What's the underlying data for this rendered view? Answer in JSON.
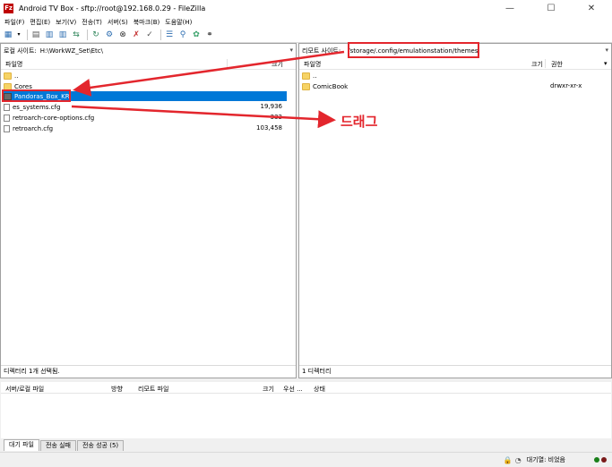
{
  "window": {
    "title": "Android TV Box - sftp://root@192.168.0.29 - FileZilla",
    "app_icon": "Fz",
    "controls": [
      "minimize-icon",
      "maximize-icon",
      "close-icon"
    ]
  },
  "menu": [
    "파일(F)",
    "편집(E)",
    "보기(V)",
    "전송(T)",
    "서버(S)",
    "북마크(B)",
    "도움말(H)"
  ],
  "toolbar_icons": [
    "site-manager-icon",
    "toggle-log-icon",
    "toggle-local-tree-icon",
    "toggle-remote-tree-icon",
    "toggle-queue-icon",
    "refresh-icon",
    "process-queue-icon",
    "cancel-icon",
    "disconnect-icon",
    "reconnect-icon",
    "filter-icon",
    "compare-icon",
    "sync-browse-icon",
    "find-icon"
  ],
  "local": {
    "address_label": "로컬 사이트:",
    "address_value": "H:\\WorkWZ_Set\\Etc\\",
    "col_name": "파일명",
    "col_size": "크기",
    "items": [
      {
        "name": "..",
        "type": "parent",
        "size": ""
      },
      {
        "name": "Cores",
        "type": "folder",
        "size": ""
      },
      {
        "name": "Pandoras_Box_KR",
        "type": "folder-selected",
        "size": ""
      },
      {
        "name": "es_systems.cfg",
        "type": "file",
        "size": "19,936"
      },
      {
        "name": "retroarch-core-options.cfg",
        "type": "file",
        "size": "333"
      },
      {
        "name": "retroarch.cfg",
        "type": "file",
        "size": "103,458"
      }
    ],
    "status": "디렉터리 1개 선택됨."
  },
  "remote": {
    "address_label": "리모트 사이트:",
    "address_value": "/storage/.config/emulationstation/themes",
    "col_name": "파일명",
    "col_size": "크기",
    "col_perm": "권한",
    "items": [
      {
        "name": "..",
        "type": "parent",
        "perm": ""
      },
      {
        "name": "ComicBook",
        "type": "folder",
        "perm": "drwxr-xr-x"
      }
    ],
    "status": "1 디렉터리"
  },
  "queue": {
    "columns": [
      "서버/로컬 파일",
      "방향",
      "리모트 파일",
      "크기",
      "우선 ...",
      "상태"
    ]
  },
  "tabs": [
    "대기 파일",
    "전송 실패",
    "전송 성공 (5)"
  ],
  "bottom": {
    "queue_label": "대기열: 비었음"
  },
  "annotation": {
    "label": "드래그",
    "color": "#e3262d"
  }
}
